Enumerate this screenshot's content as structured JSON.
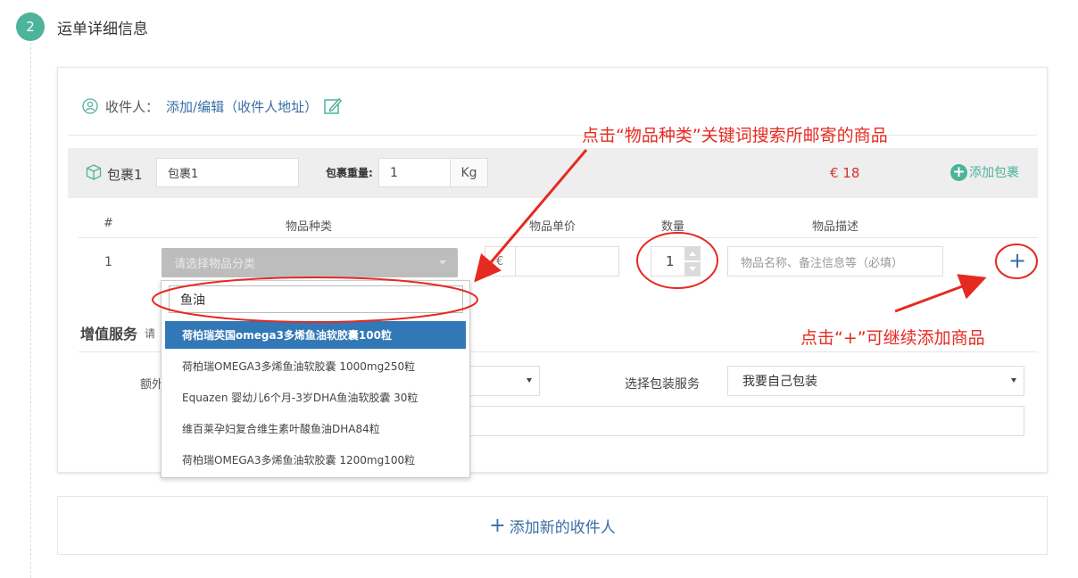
{
  "step": {
    "number": "2",
    "title": "运单详细信息"
  },
  "receiver": {
    "label": "收件人：",
    "link": "添加/编辑（收件人地址）"
  },
  "package": {
    "name": "包裹1",
    "name_value": "包裹1",
    "weight_label": "包裹重量:",
    "weight_value": "1",
    "weight_unit": "Kg",
    "price": "€ 18",
    "add_label": "添加包裹"
  },
  "table": {
    "headers": [
      "#",
      "物品种类",
      "物品单价",
      "数量",
      "物品描述"
    ],
    "row": {
      "index": "1",
      "category_placeholder": "请选择物品分类",
      "currency": "€",
      "price_value": "",
      "quantity": "1",
      "description_placeholder": "物品名称、备注信息等（必填）"
    },
    "add_item_symbol": "+"
  },
  "dropdown": {
    "search_value": "鱼油",
    "items": [
      "荷柏瑞英国omega3多烯鱼油软胶囊100粒",
      "荷柏瑞OMEGA3多烯鱼油软胶囊 1000mg250粒",
      "Equazen 婴幼儿6个月-3岁DHA鱼油软胶囊 30粒",
      "维百莱孕妇复合维生素叶酸鱼油DHA84粒",
      "荷柏瑞OMEGA3多烯鱼油软胶囊 1200mg100粒"
    ],
    "selected_index": 0
  },
  "value_added": {
    "title": "增值服务",
    "note": "请",
    "extra_label": "额外",
    "packaging_label": "选择包装服务",
    "packaging_value": "我要自己包装"
  },
  "add_receiver": {
    "plus": "+",
    "label": "添加新的收件人"
  },
  "annotations": {
    "category_hint": "点击“物品种类”关键词搜索所邮寄的商品",
    "plus_hint": "点击“+”可继续添加商品"
  },
  "colors": {
    "accent": "#4db39a",
    "link": "#3a6ea5",
    "price": "#d9302c",
    "annotation": "#e52a21",
    "selected": "#3277b6"
  }
}
